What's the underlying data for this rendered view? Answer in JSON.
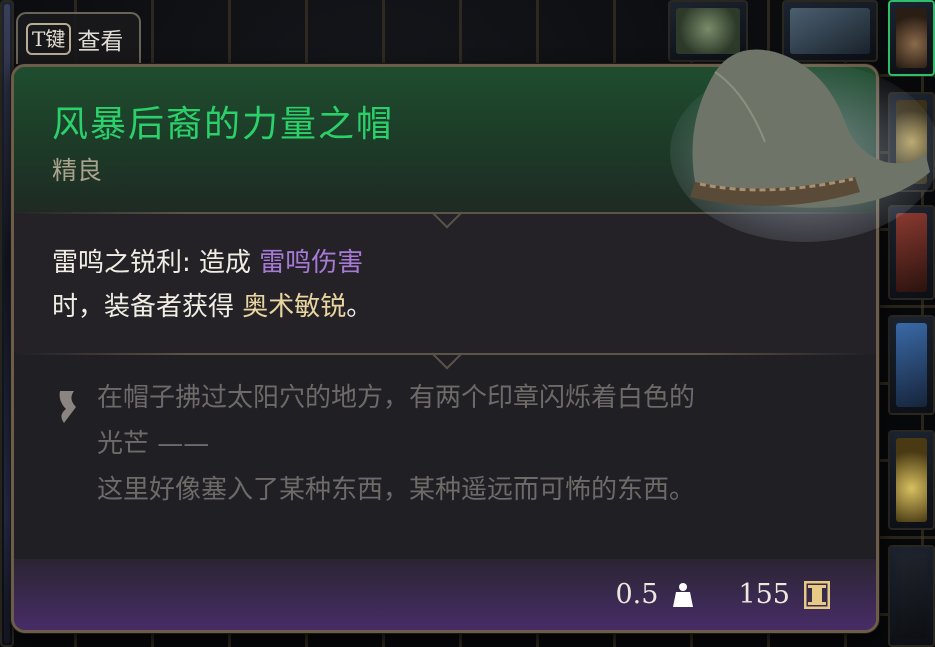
{
  "key_hint": {
    "key": "T键",
    "action": "查看"
  },
  "item": {
    "name": "风暴后裔的力量之帽",
    "rarity": "精良",
    "effect": {
      "prefix": "雷鸣之锐利: 造成 ",
      "damage_type": "雷鸣伤害",
      "mid": "时，装备者获得 ",
      "condition": "奥术敏锐",
      "suffix": "。"
    },
    "lore": {
      "line1": "在帽子拂过太阳穴的地方，有两个印章闪烁着白色的",
      "line2": "光芒 ——",
      "line3": "这里好像塞入了某种东西，某种遥远而可怖的东西。"
    },
    "weight": "0.5",
    "value": "155"
  },
  "colors": {
    "item_name": "#2bd06a",
    "rarity": "#a9a28c",
    "damage_type": "#a77ad8",
    "condition": "#e9d59f",
    "lore": "#6d6a68",
    "selected_slot": "#2fbf6a"
  },
  "icons": {
    "lore": "quill-scroll-icon",
    "weight": "weight-icon",
    "gold": "gold-coin-icon",
    "item": "wizard-hat-icon"
  }
}
